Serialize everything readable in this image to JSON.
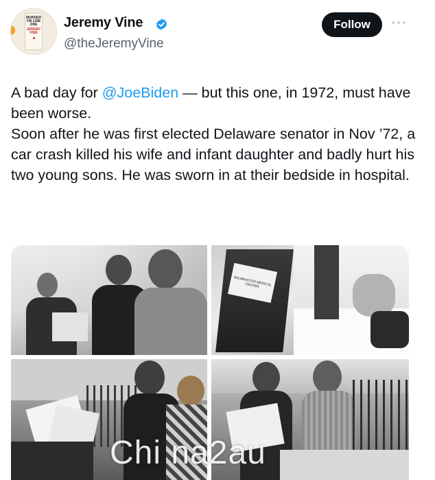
{
  "author": {
    "name": "Jeremy Vine",
    "handle": "@theJeremyVine",
    "verified_icon": "verified-badge-icon",
    "avatar_book": {
      "line1": "MURDER ON LINE ONE",
      "line2": "JEREMY VINE"
    }
  },
  "actions": {
    "follow_label": "Follow",
    "more_icon": "more-dots-icon"
  },
  "tweet": {
    "line1_prefix": "A bad day for ",
    "line1_mention": "@JoeBiden",
    "line1_suffix": " — but this one, in 1972, must have been worse.",
    "line2": "Soon after he was first elected Delaware senator in Nov ’72, a car crash killed his wife and infant daughter and badly hurt his two young sons. He was sworn in at their bedside in hospital."
  },
  "media": {
    "photo1_sign": "",
    "photo2_sign": "WILMINGTON MEDICAL CENTER"
  },
  "watermark": "Chi na2au",
  "colors": {
    "text": "#0f1419",
    "secondary": "#536471",
    "mention": "#1d9bf0",
    "follow_bg": "#0f1419",
    "verified": "#1d9bf0"
  }
}
